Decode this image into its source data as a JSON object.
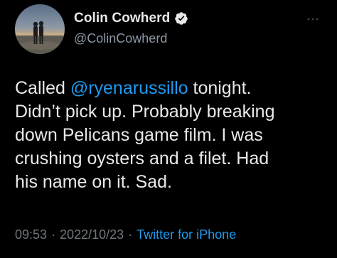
{
  "author": {
    "display_name": "Colin Cowherd",
    "handle": "@ColinCowherd",
    "avatar_icon": "profile-photo",
    "verified_icon": "verified-badge-icon"
  },
  "menu": {
    "icon": "more-icon"
  },
  "tweet": {
    "line1_prefix": "Called ",
    "mention": "@ryenarussillo",
    "line1_suffix": " tonight.",
    "line2": "Didn’t pick up. Probably breaking",
    "line3": "down Pelicans game film. I was",
    "line4": "crushing oysters and a filet. Had",
    "line5": "his name on it. Sad."
  },
  "meta": {
    "time": "09:53",
    "separator": "·",
    "date": "2022/10/23",
    "source": "Twitter for iPhone"
  },
  "colors": {
    "background": "#000000",
    "text": "#e7e9ea",
    "secondary": "#71767b",
    "accent": "#1d9bf0"
  }
}
